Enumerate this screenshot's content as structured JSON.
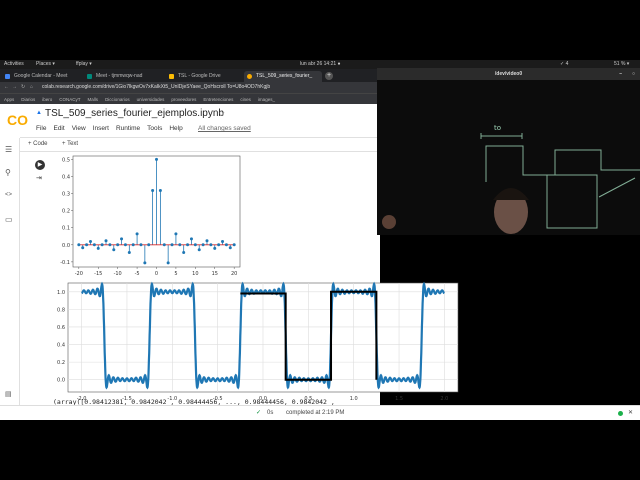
{
  "system_bar": {
    "activities": "Activities",
    "places": "Places ▾",
    "app": "ffplay ▾",
    "clock": "lun abr 26  14:21  ●",
    "battery": "51 % ▾",
    "tray_count": "✓ 4"
  },
  "browser": {
    "tabs": [
      {
        "label": "Google Calendar - Meet",
        "color": "#4285f4"
      },
      {
        "label": "Meet - tjmmwqw-nad",
        "color": "#00897b"
      },
      {
        "label": "TSL - Google Drive",
        "color": "#fbbc04"
      },
      {
        "label": "TSL_509_series_fourier_",
        "color": "#f9ab00",
        "active": true
      }
    ],
    "url": "colab.research.google.com/drive/1Gio7lkgwOv7xKaIkXt5_UnIDjeSYaee_QoHscroll To=U8o4OD7hKgjb",
    "bookmarks": [
      "Apps",
      "Diarios",
      "ibero",
      "CONACyT",
      "Malls",
      "Diccionarios",
      "universidades",
      "proveedores",
      "Entretenciones",
      "cines",
      "images_"
    ]
  },
  "colab": {
    "logo": "CO",
    "title": "TSL_509_series_fourier_ejemplos.ipynb",
    "menu": [
      "File",
      "Edit",
      "View",
      "Insert",
      "Runtime",
      "Tools",
      "Help"
    ],
    "saved": "All changes saved",
    "add_code": "+ Code",
    "add_text": "+ Text",
    "output_text": "(array([0.98412381, 0.9842042 , 0.98444456, ..., 0.98444456, 0.9842042 ,",
    "status": {
      "check": "✓",
      "time": "0s",
      "message": "completed at 2:19 PM"
    }
  },
  "video": {
    "title": "/dev/video0",
    "board_label": "to"
  },
  "chart_data": [
    {
      "type": "stem",
      "x": [
        -20,
        -19,
        -18,
        -17,
        -16,
        -15,
        -14,
        -13,
        -12,
        -11,
        -10,
        -9,
        -8,
        -7,
        -6,
        -5,
        -4,
        -3,
        -2,
        -1,
        0,
        1,
        2,
        3,
        4,
        5,
        6,
        7,
        8,
        9,
        10,
        11,
        12,
        13,
        14,
        15,
        16,
        17,
        18,
        19,
        20
      ],
      "values": [
        0,
        -0.017,
        0,
        0.019,
        0,
        -0.021,
        0,
        0.024,
        0,
        -0.029,
        0,
        0.035,
        0,
        -0.045,
        0,
        0.064,
        0,
        -0.106,
        0,
        0.318,
        0.5,
        0.318,
        0,
        -0.106,
        0,
        0.064,
        0,
        -0.045,
        0,
        0.035,
        0,
        -0.029,
        0,
        0.024,
        0,
        -0.021,
        0,
        0.019,
        0,
        -0.017,
        0
      ],
      "xlim": [
        -21.5,
        21.5
      ],
      "ylim": [
        -0.13,
        0.52
      ],
      "xticks": [
        -20,
        -15,
        -10,
        -5,
        0,
        5,
        10,
        15,
        20
      ],
      "yticks": [
        -0.1,
        0.0,
        0.1,
        0.2,
        0.3,
        0.4,
        0.5
      ],
      "ytick_labels": [
        "-0.1",
        "0.0",
        "0.1",
        "0.2",
        "0.3",
        "0.4",
        "0.5"
      ],
      "colors": {
        "stem": "#1f77b4",
        "baseline": "#d62728"
      },
      "grid": false
    },
    {
      "type": "line",
      "xlim": [
        -2.15,
        2.15
      ],
      "ylim": [
        -0.14,
        1.1
      ],
      "xticks": [
        -2.0,
        -1.5,
        -1.0,
        -0.5,
        0.0,
        0.5,
        1.0,
        1.5,
        2.0
      ],
      "xtick_labels": [
        "-2.0",
        "-1.5",
        "-1.0",
        "-0.5",
        "0.0",
        "0.5",
        "1.0",
        "1.5",
        "2.0"
      ],
      "yticks": [
        0.0,
        0.2,
        0.4,
        0.6,
        0.8,
        1.0
      ],
      "ytick_labels": [
        "0.0",
        "0.2",
        "0.4",
        "0.6",
        "0.8",
        "1.0"
      ],
      "grid": true,
      "series": [
        {
          "description_values": "Fourier partial sum, harmonics |k|<=19, period 1, x from -2 to 2",
          "color": "#1f77b4",
          "harmonics": 19,
          "x_range": [
            -2,
            2
          ]
        },
        {
          "color": "#000000",
          "x": [
            -0.25,
            0.25,
            0.25,
            0.75,
            0.75,
            1.25,
            1.25
          ],
          "y": [
            0.98,
            0.98,
            0,
            0,
            1,
            1,
            0
          ]
        }
      ]
    }
  ]
}
